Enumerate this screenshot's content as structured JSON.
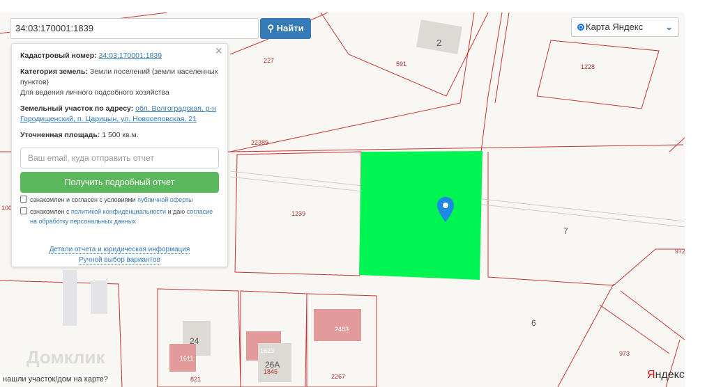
{
  "search": {
    "value": "34:03:170001:1839",
    "button": "Найти",
    "icon": "search-icon"
  },
  "layer": {
    "selected": "Карта Яндекс"
  },
  "panel": {
    "cadastral_label": "Кадастровый номер:",
    "cadastral_value": "34:03:170001:1839",
    "category_label": "Категория земель:",
    "category_value": "Земли поселений (земли населенных пунктов)",
    "usage": "Для ведения личного подсобного хозяйства",
    "address_label": "Земельный участок по адресу:",
    "address_value": "обл. Волгоградская, р-н Городищенский, п. Царицын, ул. Новосеповская, 21",
    "area_label": "Уточненная площадь:",
    "area_value": "1 500 кв.м.",
    "email_placeholder": "Ваш email, куда отправить отчет",
    "get_report": "Получить подробный отчет",
    "check1_text": "ознакомлен и согласен с условиями ",
    "check1_link": "публичной оферты",
    "check2_text": "ознакомлен с ",
    "check2_link": "политикой конфиденциальности",
    "check2_mid": " и даю ",
    "check2_link2": "согласие на обработку персональных данных",
    "details_link": "Детали отчета и юридическая информация",
    "manual_link": "Ручной выбор вариантов"
  },
  "map": {
    "labels": [
      "227",
      "591",
      "2",
      "1228",
      "22389",
      "1239",
      "7",
      "972",
      "100",
      "6",
      "973",
      "24",
      "1611",
      "1623",
      "2483",
      "26А",
      "1845",
      "821",
      "2267"
    ],
    "highlight_color": "#00f550",
    "boundary_color": "#cc3333"
  },
  "watermark": "Домклик",
  "not_found": "нашли участок/дом на карте?",
  "yandex_logo": "Яндекс"
}
